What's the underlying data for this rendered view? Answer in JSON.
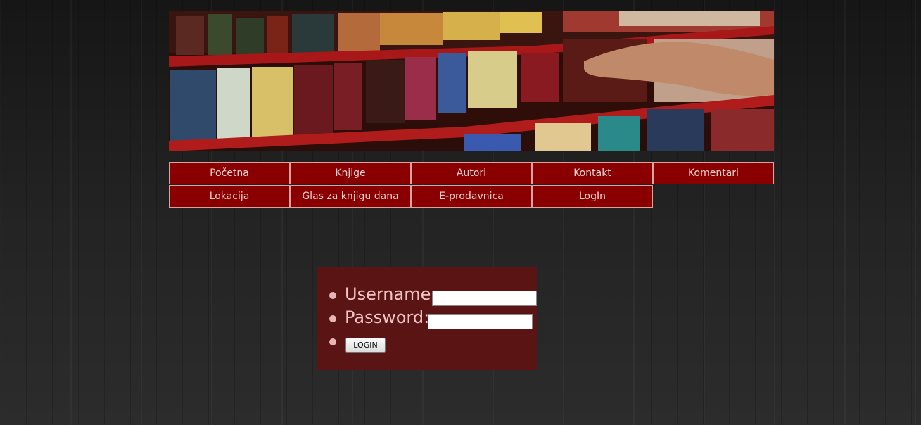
{
  "banner": {
    "icon": "bookshelf-banner-image"
  },
  "menu": {
    "items": [
      "Početna",
      "Knjige",
      "Autori",
      "Kontakt",
      "Komentari",
      "Lokacija",
      "Glas za knjigu dana",
      "E-prodavnica",
      "LogIn"
    ]
  },
  "login": {
    "username_label": "Username:",
    "password_label": "Password:",
    "username_value": "",
    "password_value": "",
    "button_label": "LOGIN"
  },
  "colors": {
    "menu_background": "#8a0000",
    "menu_border": "#d9a3a3",
    "menu_text": "#f0d4d4",
    "panel_background": "#5a1414",
    "panel_text": "#f2c4c4"
  }
}
